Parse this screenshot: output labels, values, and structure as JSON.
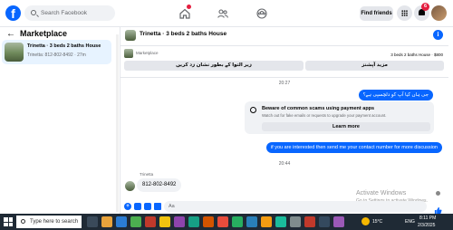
{
  "topbar": {
    "logo": "f",
    "search_placeholder": "Search Facebook",
    "find_friends": "Find friends",
    "notification_count": "6"
  },
  "sidebar": {
    "back": "←",
    "title": "Marketplace",
    "item": {
      "name": "Trinetta · 3 beds 2 baths House",
      "sub": "Trinetta: 812-802-8492 · 27m"
    }
  },
  "chat": {
    "title": "Trinetta · 3 beds 2 baths House",
    "info_icon": "i",
    "marketplace_label": "Marketplace",
    "listing_price": "3 beds 2 baths House · $800",
    "btn_mark_pending": "زیر التوا کے بطور نشان زد کریں",
    "btn_more_options": "مزید آپشنز",
    "time1": "20:27",
    "out1": "جی ہاں کیا آپ کو دلچسپی ہے؟",
    "scam_title": "Beware of common scams using payment apps",
    "scam_sub": "Watch out for fake emails or requests to upgrade your payment account.",
    "learn_more": "Learn more",
    "out2": "if you are interested then send me your contact number for more discussion",
    "time2": "20:44",
    "sender": "Trinetta",
    "in1": "812-802-8492",
    "composer_placeholder": "Aa",
    "composer_plus": "+"
  },
  "watermark": {
    "title": "Activate Windows",
    "sub": "Go to Settings to activate Windows."
  },
  "taskbar": {
    "search_placeholder": "Type here to search",
    "temperature": "15°C",
    "lang": "ENG",
    "time": "8:11 PM",
    "date": "2/3/2025"
  },
  "colors": {
    "accent": "#0866ff",
    "taskbar": "#1f2a35"
  }
}
